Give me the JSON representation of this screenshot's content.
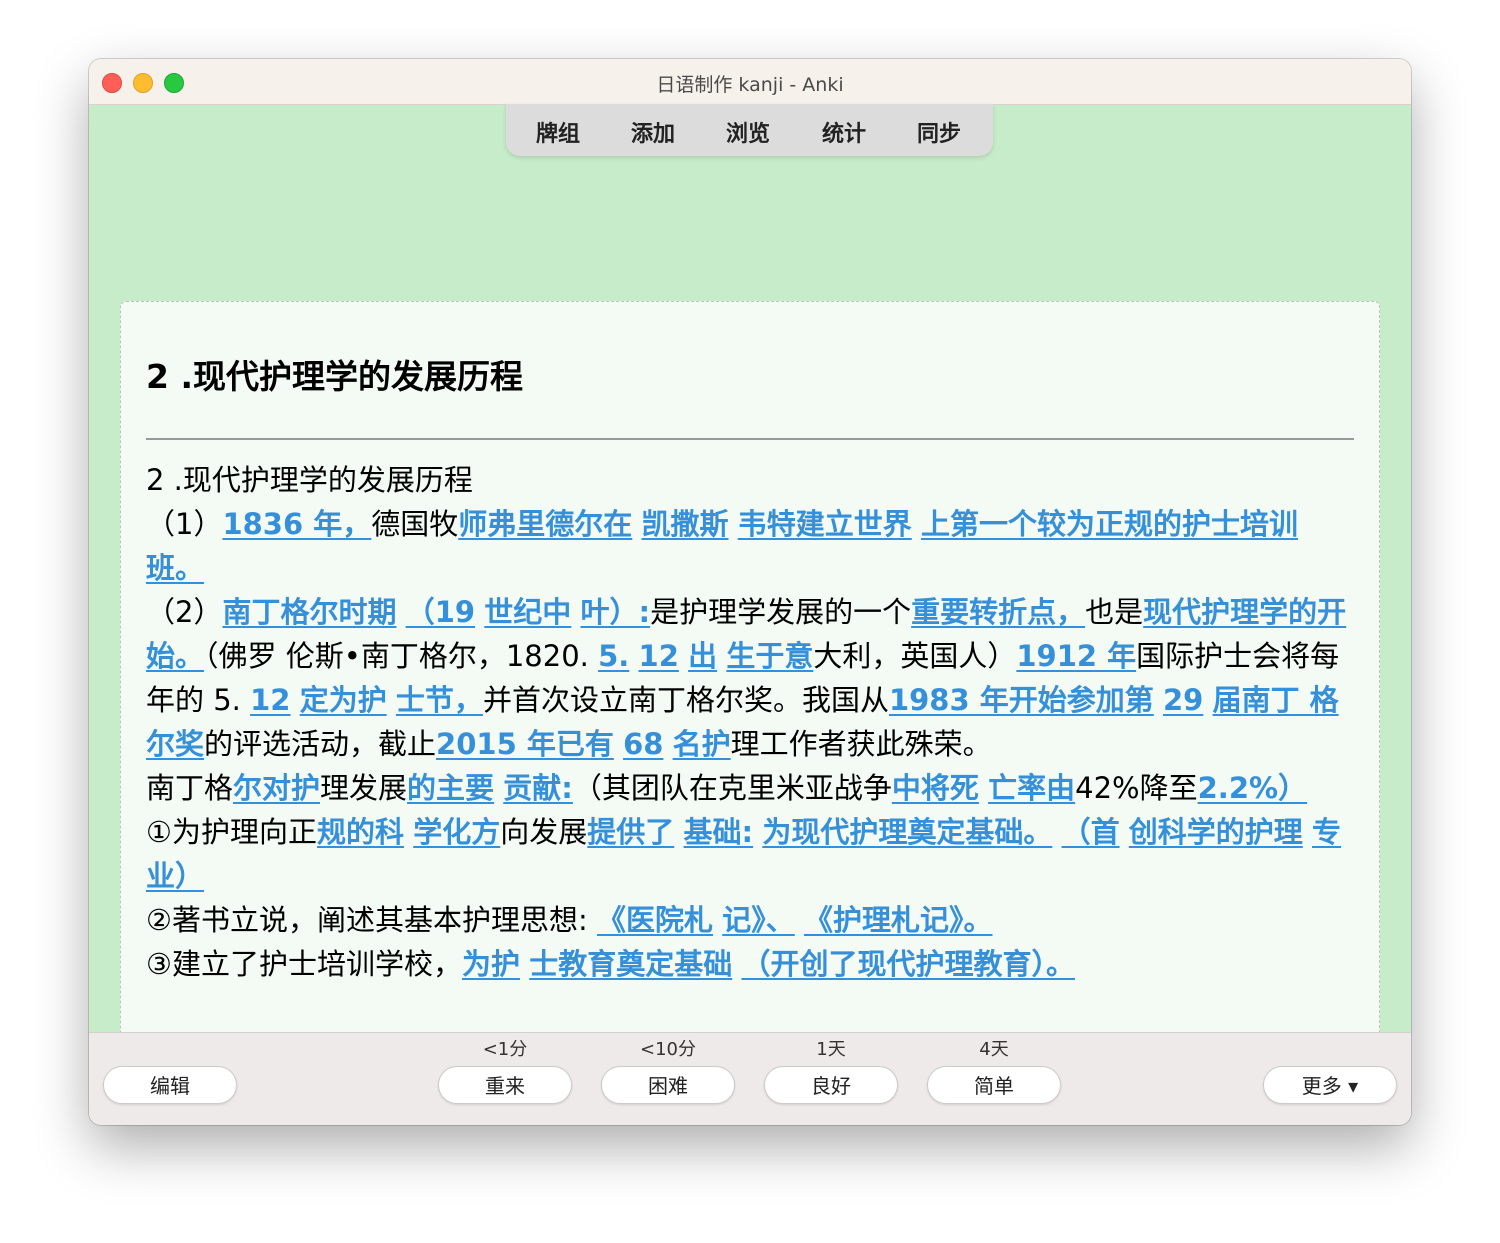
{
  "window": {
    "title": "日语制作 kanji - Anki"
  },
  "toolbar": {
    "decks": "牌组",
    "add": "添加",
    "browse": "浏览",
    "stats": "统计",
    "sync": "同步"
  },
  "card": {
    "front_title": "2 .现代护理学的发展历程",
    "answer_heading": "2 .现代护理学的发展历程",
    "p1": [
      "（1）",
      "1836 年，",
      "德国牧",
      "师弗里德尔在",
      " ",
      "凯撒斯",
      " ",
      "韦特建立世界",
      " ",
      "上第一个较为正规的护士培训班。"
    ],
    "p2": [
      "（2）",
      "南丁格尔时期",
      " ",
      "（19",
      " ",
      "世纪中",
      " ",
      "叶）:",
      "是护理学发展的一个",
      "重要转折点，",
      "也是",
      "现代护理学的开始。",
      "（佛罗 伦斯•南丁格尔，1820.",
      " ",
      "5.",
      " ",
      "12",
      " ",
      "出",
      " ",
      "生于意",
      "大利，英国人）",
      "1912 年",
      "国际护士会将每年的 5.",
      " ",
      "12",
      " ",
      "定为护",
      " ",
      "士节，",
      "并首次设立南丁格尔奖。我国从",
      "1983 年开始参加第",
      " ",
      "29",
      " ",
      "届南丁 格尔奖",
      "的评选活动，截止",
      "2015 年已有",
      " ",
      "68",
      " ",
      "名护",
      "理工作者获此殊荣。"
    ],
    "p3": [
      "南丁格",
      "尔对护",
      "理发展",
      "的主要",
      " ",
      "贡献:",
      "（其团队在克里米亚战争",
      "中将死",
      " ",
      "亡率由",
      "42%降至",
      "2.2%）"
    ],
    "p4": [
      "①为护理向正",
      "规的科",
      " ",
      "学化方",
      "向发展",
      "提供了",
      " ",
      "基础:",
      " ",
      "为现代护理奠定基础。",
      " ",
      "（首",
      " ",
      "创科学的护理",
      " ",
      "专业）"
    ],
    "p5": [
      "②著书立说，阐述其基本护理思想:",
      " ",
      "《医院札",
      " ",
      "记》、",
      " ",
      "《护理札记》。"
    ],
    "p6": [
      "③建立了护士培训学校，",
      "为护",
      " ",
      "士教育奠定基础",
      " ",
      "（开创了现代护理教育）。"
    ]
  },
  "bottom": {
    "edit": "编辑",
    "again": "重来",
    "again_interval": "<1分",
    "hard": "困难",
    "hard_interval": "<10分",
    "good": "良好",
    "good_interval": "1天",
    "easy": "简单",
    "easy_interval": "4天",
    "more": "更多 ▾"
  }
}
